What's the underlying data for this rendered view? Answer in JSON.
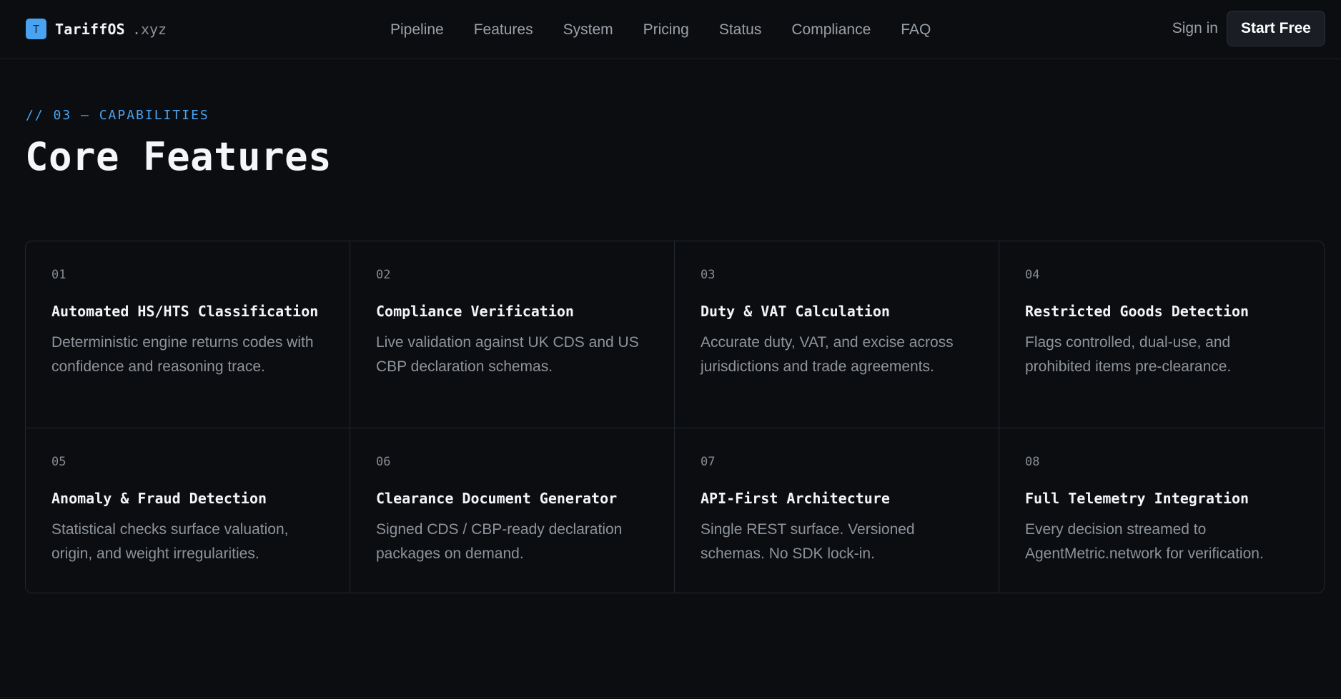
{
  "nav": {
    "brand_mark": "T",
    "brand_name": "TariffOS",
    "brand_tld": ".xyz",
    "links": [
      {
        "label": "Pipeline"
      },
      {
        "label": "Features"
      },
      {
        "label": "System"
      },
      {
        "label": "Pricing"
      },
      {
        "label": "Status"
      },
      {
        "label": "Compliance"
      },
      {
        "label": "FAQ"
      }
    ],
    "sign_in": "Sign in",
    "cta": "Start Free"
  },
  "section": {
    "tag": "// 03 — CAPABILITIES",
    "title": "Core Features"
  },
  "features": [
    {
      "num": "01",
      "title": "Automated HS/HTS Classification",
      "desc": "Deterministic engine returns codes with confidence and reasoning trace."
    },
    {
      "num": "02",
      "title": "Compliance Verification",
      "desc": "Live validation against UK CDS and US CBP declaration schemas."
    },
    {
      "num": "03",
      "title": "Duty & VAT Calculation",
      "desc": "Accurate duty, VAT, and excise across jurisdictions and trade agreements."
    },
    {
      "num": "04",
      "title": "Restricted Goods Detection",
      "desc": "Flags controlled, dual-use, and prohibited items pre-clearance."
    },
    {
      "num": "05",
      "title": "Anomaly & Fraud Detection",
      "desc": "Statistical checks surface valuation, origin, and weight irregularities."
    },
    {
      "num": "06",
      "title": "Clearance Document Generator",
      "desc": "Signed CDS / CBP-ready declaration packages on demand."
    },
    {
      "num": "07",
      "title": "API-First Architecture",
      "desc": "Single REST surface. Versioned schemas. No SDK lock-in."
    },
    {
      "num": "08",
      "title": "Full Telemetry Integration",
      "desc": "Every decision streamed to AgentMetric.network for verification."
    }
  ],
  "colors": {
    "background": "#0b0d10",
    "accent": "#4aa3f0"
  }
}
